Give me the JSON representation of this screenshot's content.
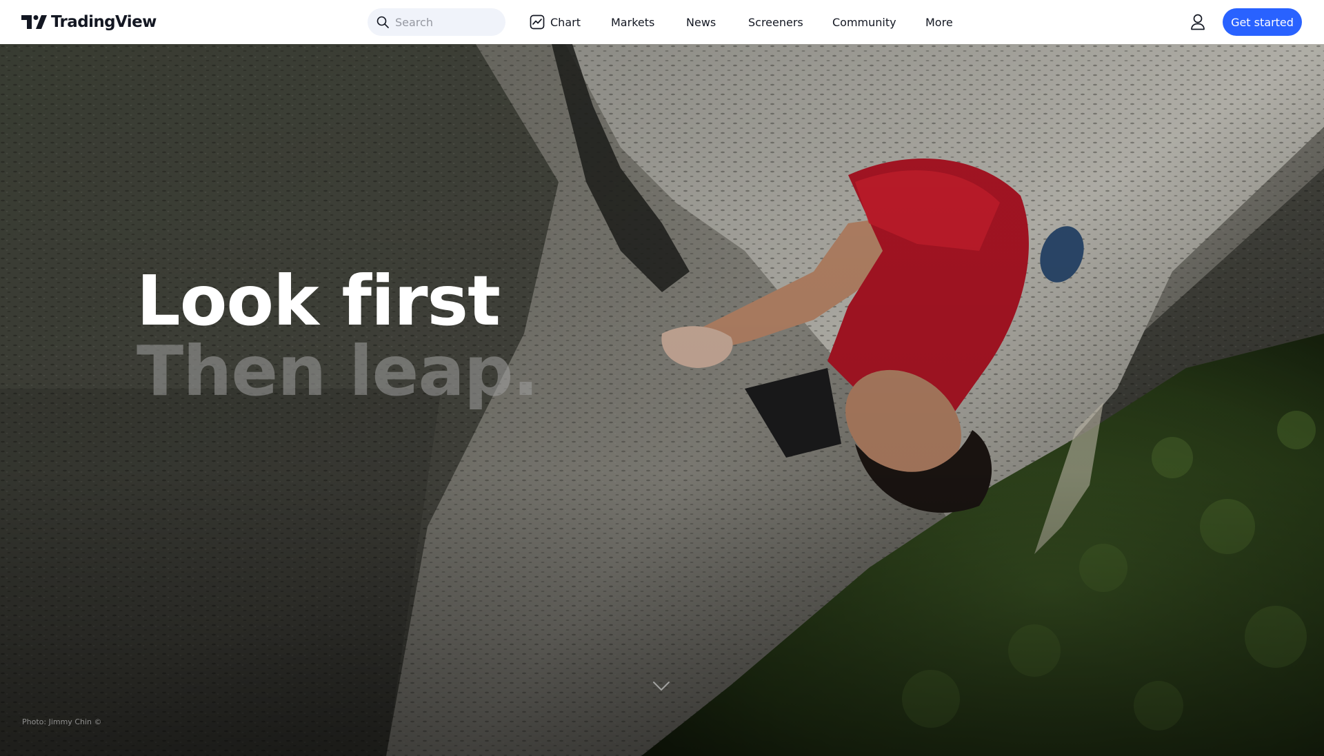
{
  "header": {
    "brand": "TradingView",
    "search": {
      "placeholder": "Search",
      "value": ""
    },
    "nav": {
      "chart": "Chart",
      "markets": "Markets",
      "news": "News",
      "screeners": "Screeners",
      "community": "Community",
      "more": "More"
    },
    "user_icon": "user-icon",
    "cta_label": "Get started"
  },
  "hero": {
    "headline_line1": "Look first",
    "headline_line2": "Then leap.",
    "photo_credit": "Photo: Jimmy Chin ©",
    "scroll_icon": "chevron-down-icon"
  },
  "colors": {
    "accent": "#2962ff",
    "header_bg": "#ffffff",
    "text": "#131722",
    "search_bg": "#f0f3fa"
  }
}
